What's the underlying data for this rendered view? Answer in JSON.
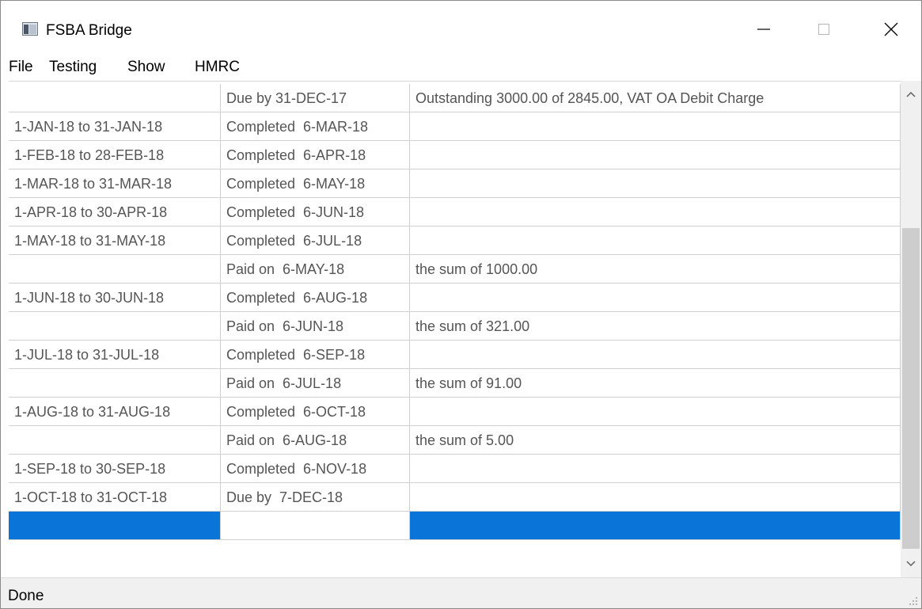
{
  "window": {
    "title": "FSBA Bridge",
    "icon": "app-window-icon"
  },
  "menu": [
    "File",
    "Testing",
    "Show",
    "HMRC"
  ],
  "rows": [
    {
      "period": "",
      "status": "Due by 31-DEC-17",
      "detail": "Outstanding 3000.00 of 2845.00, VAT OA Debit Charge"
    },
    {
      "period": "1-JAN-18 to 31-JAN-18",
      "status": "Completed  6-MAR-18",
      "detail": ""
    },
    {
      "period": "1-FEB-18 to 28-FEB-18",
      "status": "Completed  6-APR-18",
      "detail": ""
    },
    {
      "period": "1-MAR-18 to 31-MAR-18",
      "status": "Completed  6-MAY-18",
      "detail": ""
    },
    {
      "period": "1-APR-18 to 30-APR-18",
      "status": "Completed  6-JUN-18",
      "detail": ""
    },
    {
      "period": "1-MAY-18 to 31-MAY-18",
      "status": "Completed  6-JUL-18",
      "detail": ""
    },
    {
      "period": "",
      "status": "Paid on  6-MAY-18",
      "detail": "the sum of 1000.00"
    },
    {
      "period": "1-JUN-18 to 30-JUN-18",
      "status": "Completed  6-AUG-18",
      "detail": ""
    },
    {
      "period": "",
      "status": "Paid on  6-JUN-18",
      "detail": "the sum of 321.00"
    },
    {
      "period": "1-JUL-18 to 31-JUL-18",
      "status": "Completed  6-SEP-18",
      "detail": ""
    },
    {
      "period": "",
      "status": "Paid on  6-JUL-18",
      "detail": "the sum of 91.00"
    },
    {
      "period": "1-AUG-18 to 31-AUG-18",
      "status": "Completed  6-OCT-18",
      "detail": ""
    },
    {
      "period": "",
      "status": "Paid on  6-AUG-18",
      "detail": "the sum of 5.00"
    },
    {
      "period": "1-SEP-18 to 30-SEP-18",
      "status": "Completed  6-NOV-18",
      "detail": ""
    },
    {
      "period": "1-OCT-18 to 31-OCT-18",
      "status": "Due by  7-DEC-18",
      "detail": ""
    },
    {
      "period": "",
      "status": "",
      "detail": "",
      "selected": true
    }
  ],
  "statusbar": {
    "text": "Done"
  },
  "colors": {
    "selection": "#0a74d9",
    "scroll_thumb": "#cdcdcd"
  }
}
